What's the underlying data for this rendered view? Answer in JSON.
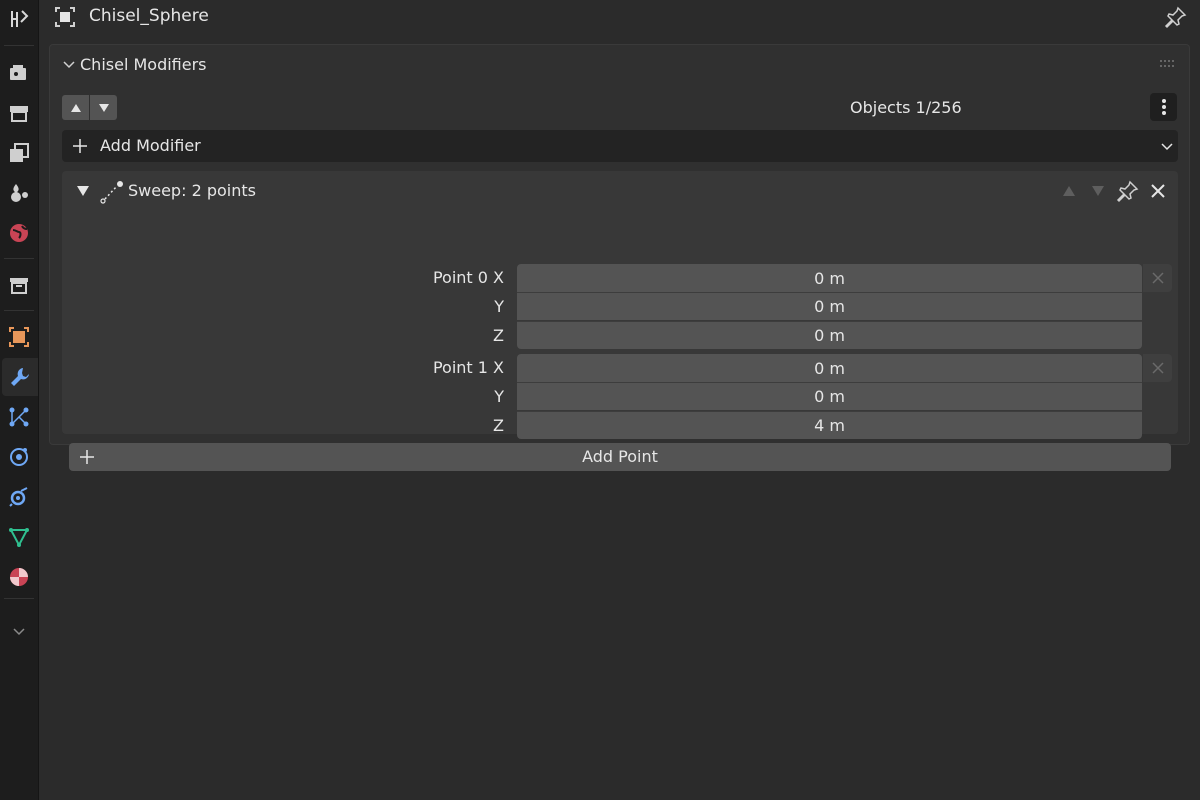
{
  "header": {
    "object_name": "Chisel_Sphere"
  },
  "tabs": [
    {
      "icon": "tool-icon"
    },
    {
      "icon": "render-icon"
    },
    {
      "icon": "output-icon"
    },
    {
      "icon": "view-layer-icon"
    },
    {
      "icon": "scene-icon"
    },
    {
      "icon": "world-icon"
    },
    {
      "icon": "collection-icon"
    },
    {
      "icon": "object-icon"
    },
    {
      "icon": "modifier-wrench-icon",
      "active": true
    },
    {
      "icon": "particles-icon"
    },
    {
      "icon": "physics-icon"
    },
    {
      "icon": "constraints-icon"
    },
    {
      "icon": "data-mesh-icon"
    },
    {
      "icon": "material-icon"
    }
  ],
  "panel": {
    "title": "Chisel Modifiers",
    "objects_count": "Objects 1/256",
    "add_modifier_label": "Add Modifier"
  },
  "modifier": {
    "title": "Sweep: 2 points",
    "points": [
      {
        "labels": {
          "x": "Point 0 X",
          "y": "Y",
          "z": "Z"
        },
        "values": {
          "x": "0 m",
          "y": "0 m",
          "z": "0 m"
        }
      },
      {
        "labels": {
          "x": "Point 1 X",
          "y": "Y",
          "z": "Z"
        },
        "values": {
          "x": "0 m",
          "y": "0 m",
          "z": "4 m"
        }
      }
    ],
    "add_point_label": "Add Point"
  },
  "colors": {
    "background": "#2b2b2b",
    "tabstrip": "#1d1d1d",
    "field": "#545454",
    "object_orange": "#e8975a",
    "wrench_blue": "#6fa8f5"
  }
}
